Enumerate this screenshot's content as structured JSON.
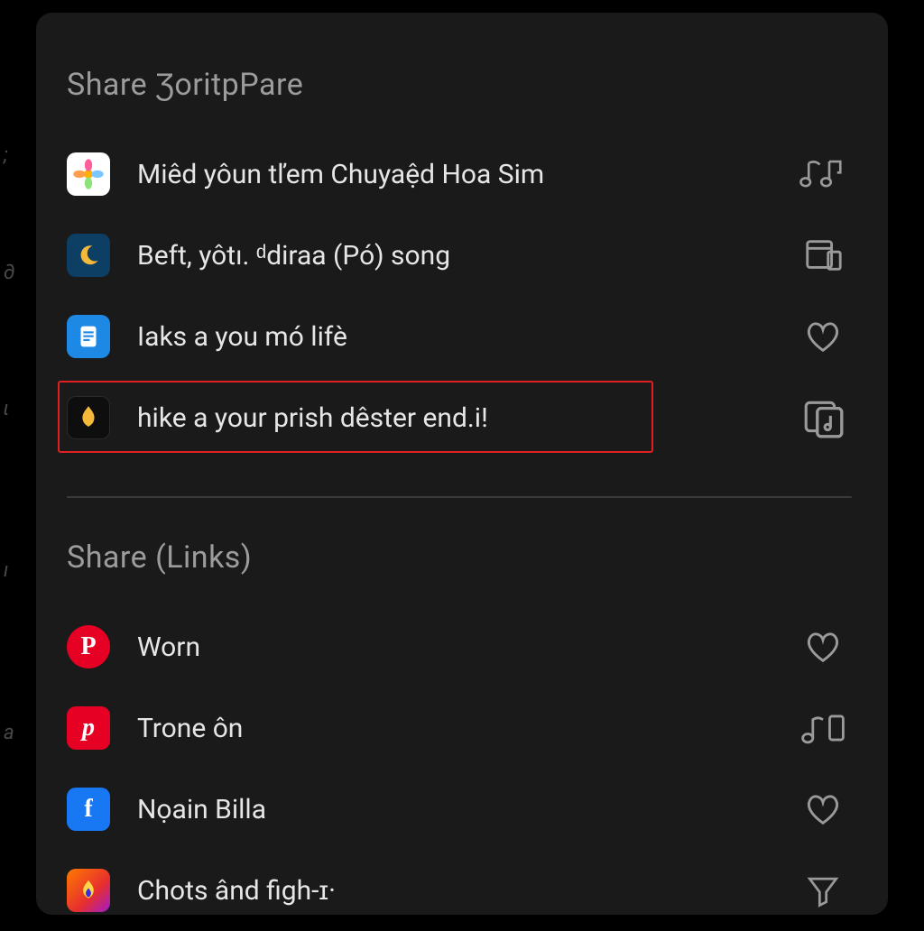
{
  "section1": {
    "title": "Share ƷoritpPare",
    "items": [
      {
        "label": "Miêd yôun tľem Chuyaệd Hoa Sim",
        "icon": "flower-app-icon",
        "action": "music-note-icon"
      },
      {
        "label": "Beft, yôtı. ᵈdiraa (Pó) song",
        "icon": "moon-app-icon",
        "action": "window-icon"
      },
      {
        "label": "Iaks a you mó lifè",
        "icon": "doc-app-icon",
        "action": "heart-icon"
      },
      {
        "label": "hike a your prish dêster end.i!",
        "icon": "flame-app-icon",
        "action": "music-square-icon",
        "highlighted": true
      }
    ]
  },
  "section2": {
    "title": "Share (Links)",
    "items": [
      {
        "label": "Worn",
        "icon": "pinterest-round-icon",
        "action": "heart-icon"
      },
      {
        "label": "Trone ôn",
        "icon": "pinterest-icon",
        "action": "music-note-icon"
      },
      {
        "label": "Nọain Billa",
        "icon": "facebook-icon",
        "action": "heart-icon"
      },
      {
        "label": "Chots ând figh-ɪ·",
        "icon": "fire-gradient-icon",
        "action": "funnel-icon"
      }
    ]
  },
  "colors": {
    "highlight": "#e02020",
    "panel_bg": "#1a1a1a",
    "text": "#e6e6e6",
    "muted": "#9c9c9c",
    "icon": "#9a9a9a"
  }
}
